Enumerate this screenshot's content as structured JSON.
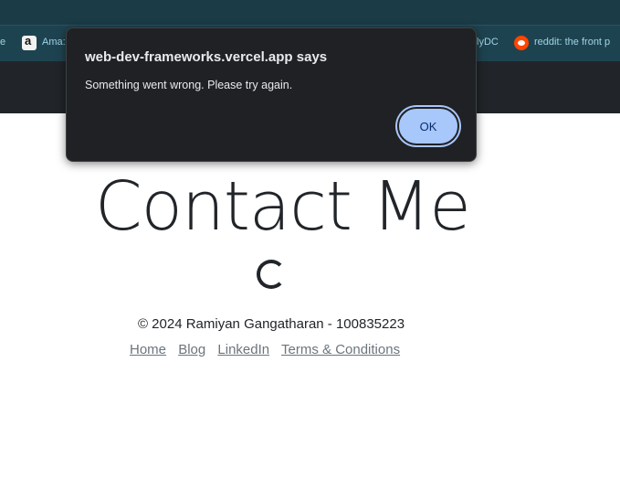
{
  "browser": {
    "bookmarks": [
      {
        "label": "e",
        "icon": "none"
      },
      {
        "label": "Ama:",
        "icon": "amazon-icon"
      },
      {
        "label": "lyDC",
        "icon": "none"
      },
      {
        "label": "reddit: the front p",
        "icon": "reddit-icon"
      }
    ]
  },
  "page": {
    "heading": "Contact Me",
    "footer": {
      "copyright": "© 2024 Ramiyan Gangatharan - 100835223",
      "links": [
        "Home",
        "Blog",
        "LinkedIn",
        "Terms & Conditions"
      ]
    }
  },
  "dialog": {
    "title": "web-dev-frameworks.vercel.app says",
    "message": "Something went wrong. Please try again.",
    "ok_label": "OK"
  },
  "colors": {
    "browser_titlebar": "#1b3b47",
    "bookmarks_bar": "#1e4350",
    "navbar": "#212529",
    "dialog_bg": "#202124",
    "ok_button": "#a8c7fa",
    "link": "#6c757d"
  }
}
